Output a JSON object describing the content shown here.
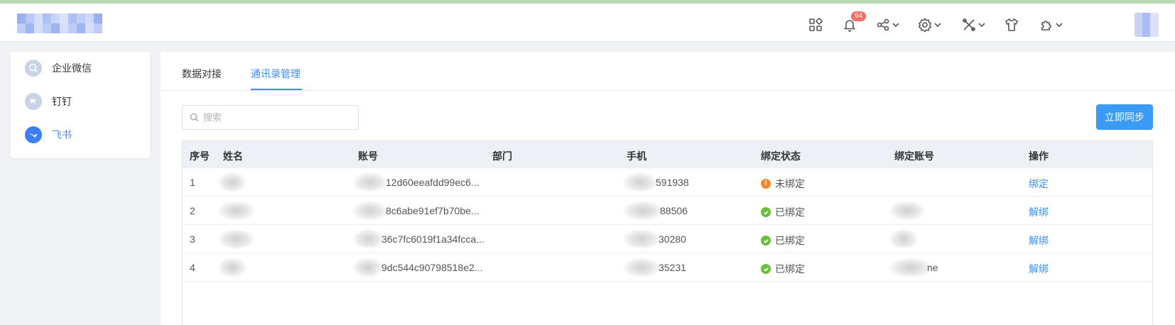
{
  "header": {
    "notification_count": "94",
    "icons": [
      "apps-icon",
      "bell-icon",
      "share-icon",
      "gear-icon",
      "tools-icon",
      "shirt-icon",
      "plugin-icon"
    ]
  },
  "sidebar": {
    "items": [
      {
        "label": "企业微信",
        "icon": "wecom-icon",
        "active": false
      },
      {
        "label": "钉钉",
        "icon": "dingtalk-icon",
        "active": false
      },
      {
        "label": "飞书",
        "icon": "feishu-icon",
        "active": true
      }
    ]
  },
  "tabs": [
    {
      "label": "数据对接",
      "active": false
    },
    {
      "label": "通讯录管理",
      "active": true
    }
  ],
  "search": {
    "placeholder": "搜索"
  },
  "sync_button": "立即同步",
  "table": {
    "columns": [
      "序号",
      "姓名",
      "账号",
      "部门",
      "手机",
      "绑定状态",
      "绑定账号",
      "操作"
    ],
    "rows": [
      {
        "index": "1",
        "account": "12d60eeafdd99ec6...",
        "phone": "591938",
        "status": "未绑定",
        "status_type": "unbound",
        "bound_account": "",
        "action": "绑定"
      },
      {
        "index": "2",
        "account": "8c6abe91ef7b70be...",
        "phone": "88506",
        "status": "已绑定",
        "status_type": "bound",
        "bound_account": "",
        "action": "解绑"
      },
      {
        "index": "3",
        "account": "36c7fc6019f1a34fcca...",
        "phone": "30280",
        "status": "已绑定",
        "status_type": "bound",
        "bound_account": "",
        "action": "解绑"
      },
      {
        "index": "4",
        "account": "9dc544c90798518e2...",
        "phone": "35231",
        "status": "已绑定",
        "status_type": "bound",
        "bound_account": "ne",
        "action": "解绑"
      }
    ]
  },
  "colors": {
    "accent": "#3e8ef7",
    "button": "#3a9bf5",
    "bound": "#67c23a",
    "unbound": "#f08a2e",
    "badge": "#f56c6c"
  }
}
